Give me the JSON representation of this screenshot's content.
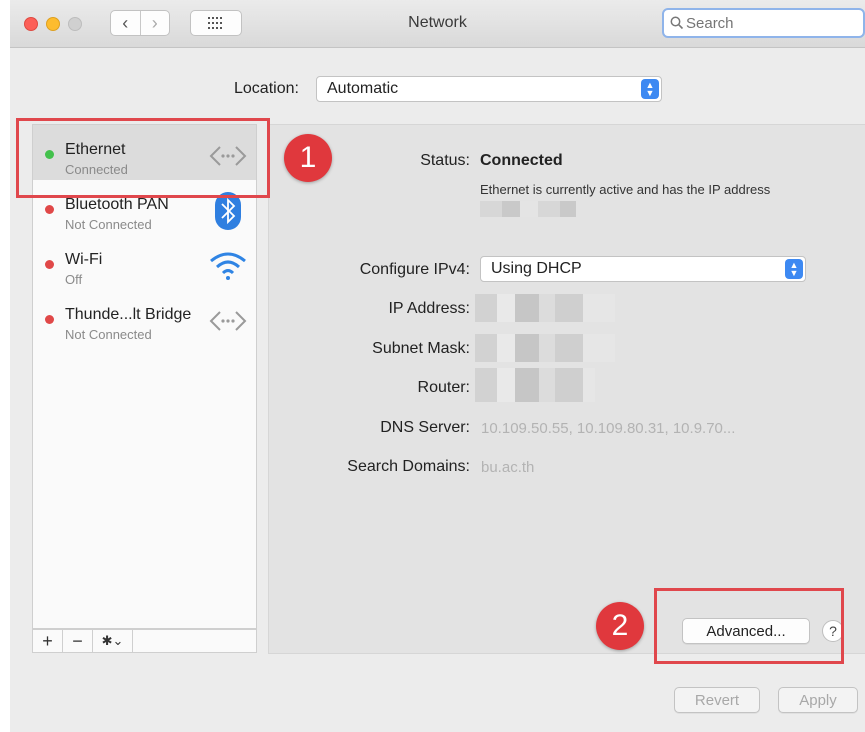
{
  "window": {
    "title": "Network"
  },
  "search": {
    "placeholder": "Search"
  },
  "location": {
    "label": "Location:",
    "value": "Automatic"
  },
  "services": [
    {
      "name": "Ethernet",
      "status": "Connected",
      "status_color": "#43c14c",
      "icon": "ethernet-arrows-icon",
      "selected": true
    },
    {
      "name": "Bluetooth PAN",
      "status": "Not Connected",
      "status_color": "#e04848",
      "icon": "bluetooth-icon",
      "selected": false
    },
    {
      "name": "Wi-Fi",
      "status": "Off",
      "status_color": "#e04848",
      "icon": "wifi-icon",
      "selected": false
    },
    {
      "name": "Thunde...lt Bridge",
      "status": "Not Connected",
      "status_color": "#e04848",
      "icon": "ethernet-arrows-icon",
      "selected": false
    }
  ],
  "sidebar_footer": {
    "add": "+",
    "remove": "−",
    "gear": "✱⌄"
  },
  "detail": {
    "status_label": "Status:",
    "status_value": "Connected",
    "status_description": "Ethernet is currently active and has the IP address",
    "configure_label": "Configure IPv4:",
    "configure_value": "Using DHCP",
    "ip_label": "IP Address:",
    "subnet_label": "Subnet Mask:",
    "router_label": "Router:",
    "dns_label": "DNS Server:",
    "dns_value": "10.109.50.55, 10.109.80.31, 10.9.70...",
    "domains_label": "Search Domains:",
    "domains_value": "bu.ac.th"
  },
  "buttons": {
    "advanced": "Advanced...",
    "help": "?",
    "revert": "Revert",
    "apply": "Apply"
  },
  "annotations": {
    "one": "1",
    "two": "2",
    "color": "#e0474c"
  }
}
